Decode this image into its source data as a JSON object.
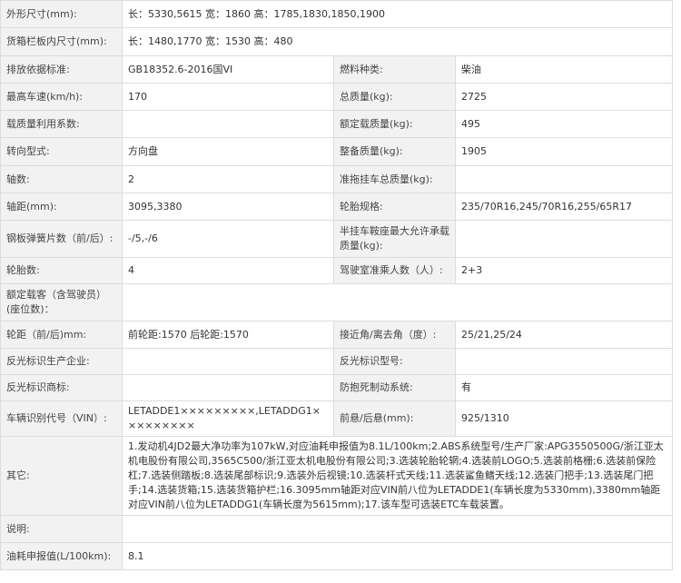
{
  "rows": [
    {
      "label": "外形尺寸(mm):",
      "value": "长：5330,5615 宽：1860 高：1785,1830,1850,1900"
    },
    {
      "label": "货箱栏板内尺寸(mm):",
      "value": "长：1480,1770 宽：1530 高：480"
    },
    {
      "label": "排放依据标准:",
      "value": "GB18352.6-2016国VI",
      "label2": "燃料种类:",
      "value2": "柴油"
    },
    {
      "label": "最高车速(km/h):",
      "value": "170",
      "label2": "总质量(kg):",
      "value2": "2725"
    },
    {
      "label": "载质量利用系数:",
      "value": "",
      "label2": "额定载质量(kg):",
      "value2": "495"
    },
    {
      "label": "转向型式:",
      "value": "方向盘",
      "label2": "整备质量(kg):",
      "value2": "1905"
    },
    {
      "label": "轴数:",
      "value": "2",
      "label2": "准拖挂车总质量(kg):",
      "value2": ""
    },
    {
      "label": "轴距(mm):",
      "value": "3095,3380",
      "label2": "轮胎规格:",
      "value2": "235/70R16,245/70R16,255/65R17"
    },
    {
      "label": "钢板弹簧片数（前/后）:",
      "value": "-/5,-/6",
      "label2": "半挂车鞍座最大允许承载质量(kg):",
      "value2": ""
    },
    {
      "label": "轮胎数:",
      "value": "4",
      "label2": "驾驶室准乘人数（人）:",
      "value2": "2+3"
    },
    {
      "label": "额定载客（含驾驶员）(座位数)：",
      "value": ""
    },
    {
      "label": "轮距（前/后)mm:",
      "value": "前轮距:1570 后轮距:1570",
      "label2": "接近角/离去角（度）:",
      "value2": "25/21,25/24"
    },
    {
      "label": "反光标识生产企业:",
      "value": "",
      "label2": "反光标识型号:",
      "value2": ""
    },
    {
      "label": "反光标识商标:",
      "value": "",
      "label2": "防抱死制动系统:",
      "value2": "有"
    },
    {
      "label": "车辆识别代号（VIN）:",
      "value": "LETADDE1×××××××××,LETADDG1×××××××××",
      "label2": "前悬/后悬(mm):",
      "value2": "925/1310"
    },
    {
      "label": "其它:",
      "value": "1.发动机4JD2最大净功率为107kW,对应油耗申报值为8.1L/100km;2.ABS系统型号/生产厂家:APG3550500G/浙江亚太机电股份有限公司,3565C500/浙江亚太机电股份有限公司;3.选装轮胎轮辋;4.选装前LOGO;5.选装前格栅;6.选装前保险杠;7.选装侧踏板;8.选装尾部标识;9.选装外后视镜;10.选装杆式天线;11.选装鲨鱼鳍天线;12.选装门把手;13.选装尾门把手;14.选装货箱;15.选装货箱护栏;16.3095mm轴距对应VIN前八位为LETADDE1(车辆长度为5330mm),3380mm轴距对应VIN前八位为LETADDG1(车辆长度为5615mm);17.该车型可选装ETC车载装置。"
    },
    {
      "label": "说明:",
      "value": ""
    },
    {
      "label": "油耗申报值(L/100km):",
      "value": "8.1"
    }
  ]
}
